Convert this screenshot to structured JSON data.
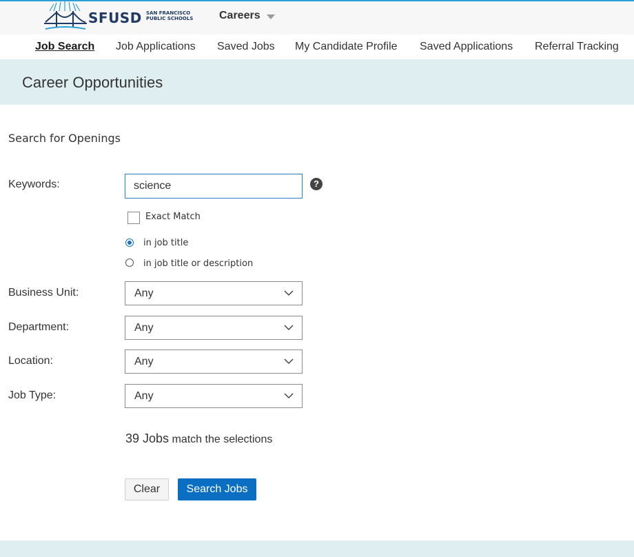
{
  "header": {
    "logo_text": "SFUSD",
    "logo_subtext": "SAN FRANCISCO PUBLIC SCHOOLS",
    "menu_label": "Careers"
  },
  "nav": {
    "items": [
      {
        "label": "Job Search",
        "active": true
      },
      {
        "label": "Job Applications"
      },
      {
        "label": "Saved Jobs"
      },
      {
        "label": "My Candidate Profile"
      },
      {
        "label": "Saved Applications"
      },
      {
        "label": "Referral Tracking"
      }
    ]
  },
  "banner": {
    "title": "Career Opportunities"
  },
  "form": {
    "section_title": "Search for Openings",
    "keywords_label": "Keywords:",
    "keywords_value": "science",
    "help_glyph": "?",
    "exact_match_label": "Exact Match",
    "exact_match_checked": false,
    "radio_options": [
      {
        "label": "in job title",
        "checked": true
      },
      {
        "label": "in job title or description",
        "checked": false
      }
    ],
    "filters": [
      {
        "label": "Business Unit:",
        "value": "Any"
      },
      {
        "label": "Department:",
        "value": "Any"
      },
      {
        "label": "Location:",
        "value": "Any"
      },
      {
        "label": "Job Type:",
        "value": "Any"
      }
    ]
  },
  "results": {
    "count_text": "39 Jobs",
    "suffix": "match the selections"
  },
  "buttons": {
    "clear": "Clear",
    "search": "Search Jobs"
  },
  "colors": {
    "accent": "#0a6fc2",
    "banner_bg": "#dfeff1",
    "logo_navy": "#1f3a64"
  }
}
